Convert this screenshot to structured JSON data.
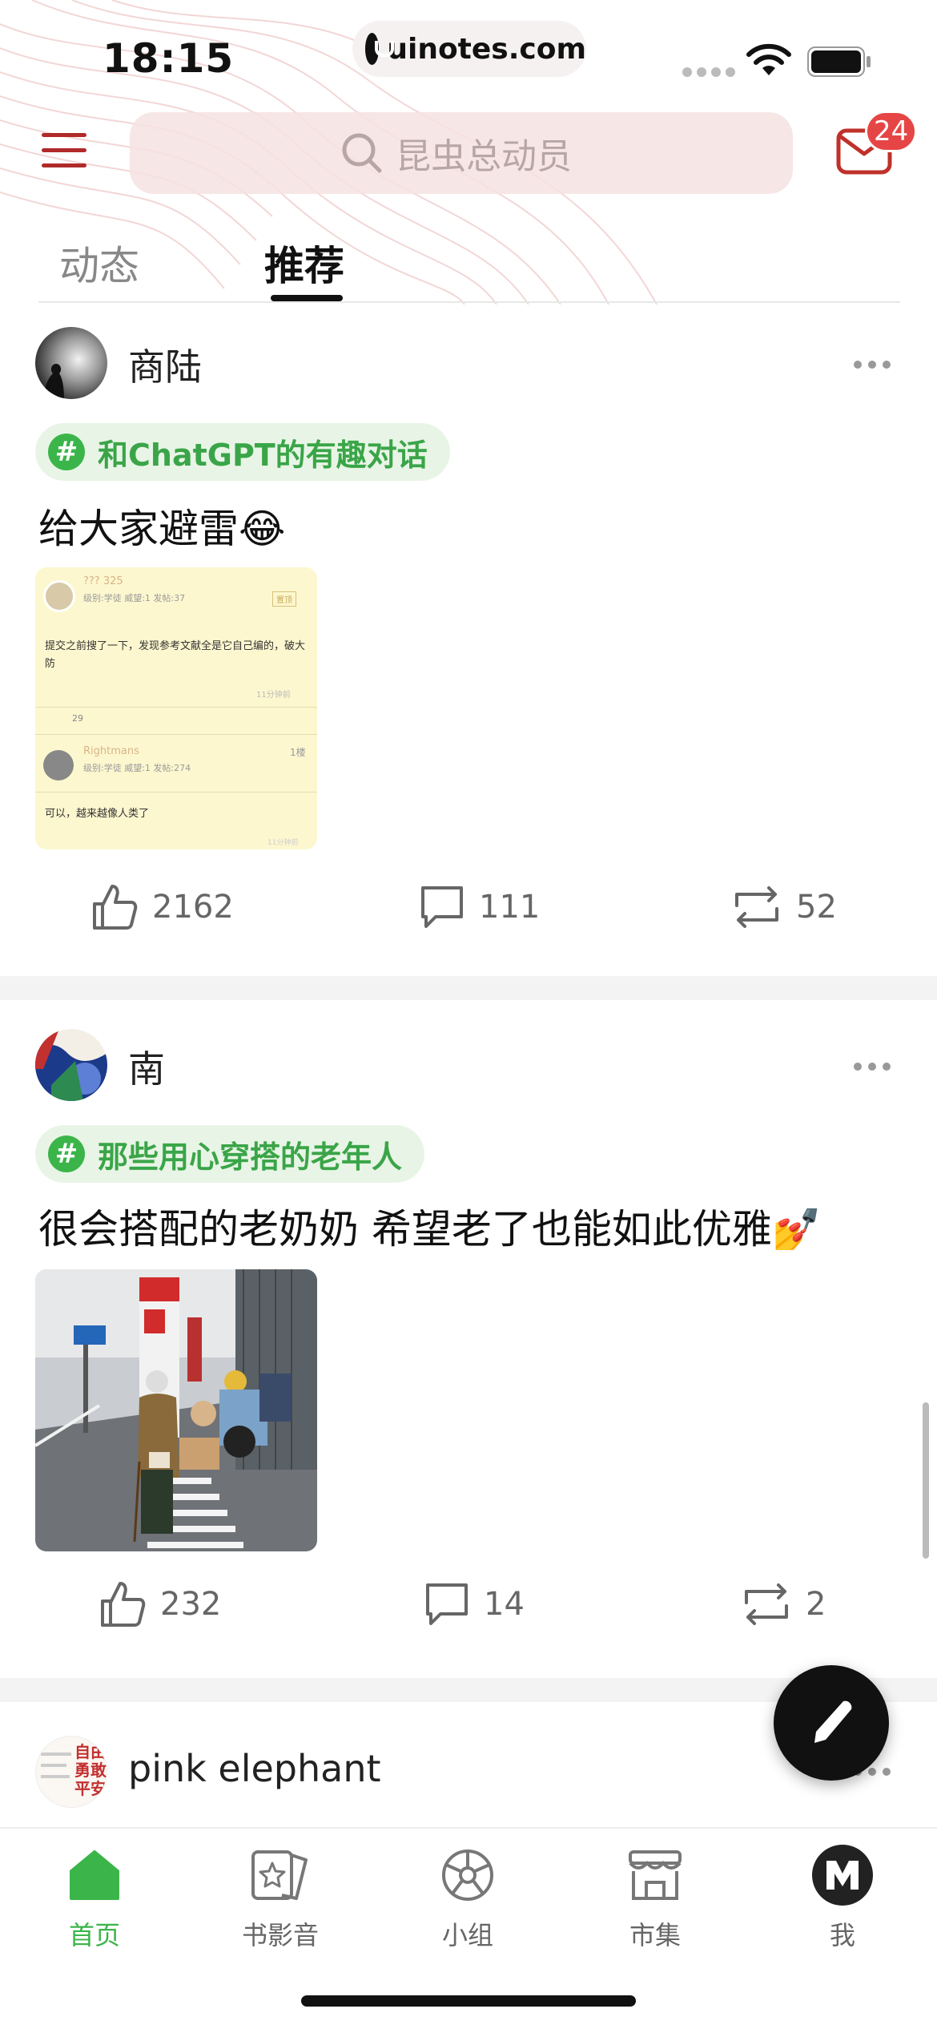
{
  "status_bar": {
    "time": "18:15",
    "url": "uinotes.com"
  },
  "header": {
    "search_placeholder": "昆虫总动员",
    "mail_badge": "24"
  },
  "tabs": [
    {
      "label": "动态"
    },
    {
      "label": "推荐"
    }
  ],
  "posts": [
    {
      "username": "商陆",
      "topic": "和ChatGPT的有趣对话",
      "text": "给大家避雷😂",
      "likes": "2162",
      "comments": "111",
      "reposts": "52",
      "image": {
        "top_user": "??? 325",
        "top_meta": "级别:学徒 威望:1 发帖:37",
        "top_tag": "置顶",
        "body": "提交之前搜了一下，发现参考文献全是它自己编的，破大防",
        "time1": "11分钟前",
        "like_count": "29",
        "reply_user": "Rightmans",
        "reply_meta": "级别:学徒 威望:1 发帖:274",
        "reply_floor": "1楼",
        "reply_body": "可以，越来越像人类了",
        "time2": "11分钟前"
      }
    },
    {
      "username": "南",
      "topic": "那些用心穿搭的老年人",
      "text": "很会搭配的老奶奶 希望老了也能如此优雅💅",
      "likes": "232",
      "comments": "14",
      "reposts": "2"
    },
    {
      "username": "pink elephant",
      "avatar_text": [
        "自由",
        "勇敢",
        "平安"
      ]
    }
  ],
  "bottom_nav": [
    {
      "label": "首页",
      "icon": "home-icon",
      "active": true
    },
    {
      "label": "书影音",
      "icon": "media-icon",
      "active": false
    },
    {
      "label": "小组",
      "icon": "group-icon",
      "active": false
    },
    {
      "label": "市集",
      "icon": "market-icon",
      "active": false
    },
    {
      "label": "我",
      "icon": "profile-icon",
      "active": false
    }
  ],
  "colors": {
    "accent": "#3bb54a",
    "brand_red": "#b02a2a",
    "badge": "#e64545"
  }
}
